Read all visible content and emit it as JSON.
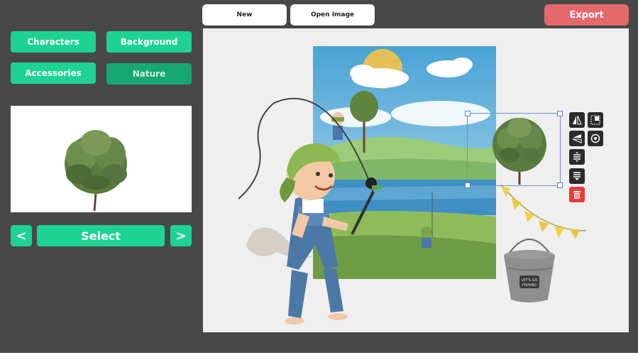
{
  "toolbar": {
    "new_label": "New",
    "open_label": "Open Image",
    "export_label": "Export"
  },
  "categories": [
    {
      "label": "Characters"
    },
    {
      "label": "Background"
    },
    {
      "label": "Accessories"
    },
    {
      "label": "Nature"
    }
  ],
  "nav": {
    "prev_label": "<",
    "select_label": "Select",
    "next_label": ">"
  },
  "bucket_text": "LET'S GO FISHING",
  "colors": {
    "accent": "#1dd393",
    "export": "#e5686b",
    "panel": "#484848",
    "canvas": "#efefef",
    "delete": "#ec3a3a"
  },
  "icons": {
    "tools": [
      "flip-horizontal-icon",
      "crop-icon",
      "flip-vertical-icon",
      "rotate-icon",
      "bring-forward-icon",
      "send-backward-icon",
      "delete-icon"
    ]
  }
}
